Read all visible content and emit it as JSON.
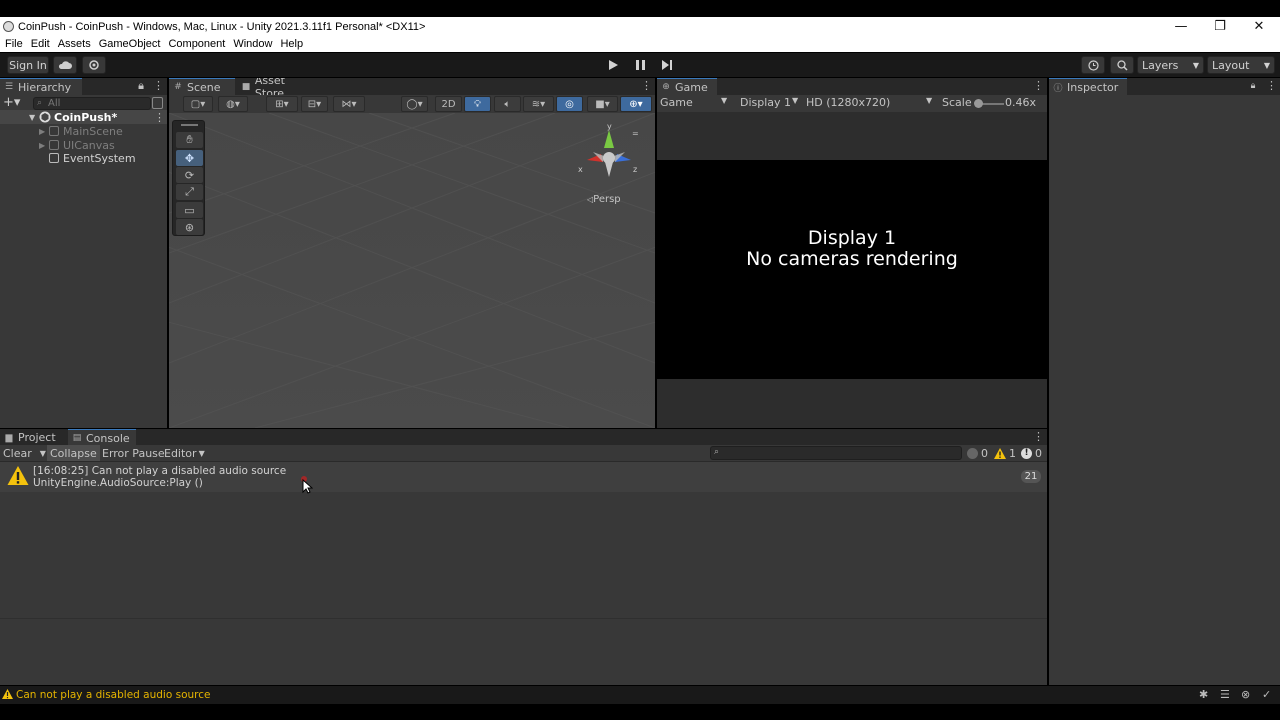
{
  "window": {
    "title": "CoinPush - CoinPush - Windows, Mac, Linux - Unity 2021.3.11f1 Personal* <DX11>",
    "minimize": "—",
    "maximize": "❐",
    "close": "✕"
  },
  "menu": [
    "File",
    "Edit",
    "Assets",
    "GameObject",
    "Component",
    "Window",
    "Help"
  ],
  "toolbar": {
    "sign_in": "Sign In",
    "layers": "Layers",
    "layout": "Layout"
  },
  "hierarchy": {
    "tab": "Hierarchy",
    "search_placeholder": "All",
    "root": "CoinPush*",
    "items": [
      "MainScene",
      "UICanvas",
      "EventSystem"
    ]
  },
  "scene": {
    "tabs": [
      "Scene",
      "Asset Store"
    ],
    "btn_2d": "2D",
    "persp": "Persp",
    "axis_y": "y",
    "axis_x": "x",
    "axis_z": "z"
  },
  "game": {
    "tab": "Game",
    "mode": "Game",
    "display": "Display 1",
    "resolution": "HD (1280x720)",
    "scale_label": "Scale",
    "scale_value": "0.46x",
    "message_line1": "Display 1",
    "message_line2": "No cameras rendering"
  },
  "inspector": {
    "tab": "Inspector"
  },
  "console": {
    "tabs": [
      "Project",
      "Console"
    ],
    "clear": "Clear",
    "collapse": "Collapse",
    "error_pause": "Error Pause",
    "editor": "Editor",
    "counts": {
      "info": "0",
      "warn": "1",
      "error": "0"
    },
    "log": {
      "line1": "[16:08:25] Can not play a disabled audio source",
      "line2": "UnityEngine.AudioSource:Play ()",
      "count": "21"
    }
  },
  "status": {
    "message": "Can not play a disabled audio source"
  },
  "colors": {
    "accent": "#3a79bb",
    "warning": "#f4c20d",
    "panel": "#383838"
  }
}
